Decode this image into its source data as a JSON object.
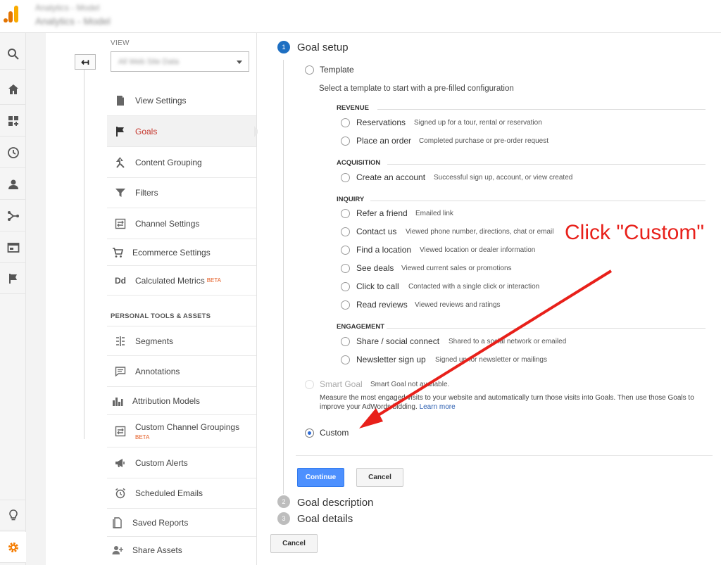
{
  "header": {
    "account_line1": "Analytics - Model",
    "account_line2": "Analytics - Model"
  },
  "rail": {
    "items": [
      "search-icon",
      "home-icon",
      "dashboard-icon",
      "clock-icon",
      "person-icon",
      "flow-icon",
      "window-icon",
      "flag-icon"
    ],
    "bottom": [
      "lightbulb-icon",
      "gear-icon"
    ],
    "accent": "#f57c00"
  },
  "admin": {
    "view_label": "VIEW",
    "view_value": "All Web Site Data",
    "menu": [
      {
        "label": "View Settings"
      },
      {
        "label": "Goals"
      },
      {
        "label": "Content Grouping"
      },
      {
        "label": "Filters"
      },
      {
        "label": "Channel Settings"
      },
      {
        "label": "Ecommerce Settings"
      },
      {
        "label": "Calculated Metrics",
        "badge": "BETA"
      }
    ],
    "section_head": "PERSONAL TOOLS & ASSETS",
    "tools": [
      {
        "label": "Segments"
      },
      {
        "label": "Annotations"
      },
      {
        "label": "Attribution Models"
      },
      {
        "label": "Custom Channel Groupings",
        "badge": "BETA"
      },
      {
        "label": "Custom Alerts"
      },
      {
        "label": "Scheduled Emails"
      },
      {
        "label": "Saved Reports"
      },
      {
        "label": "Share Assets"
      }
    ],
    "dd_glyph": "Dd"
  },
  "goal": {
    "steps": [
      {
        "num": "1",
        "title": "Goal setup"
      },
      {
        "num": "2",
        "title": "Goal description"
      },
      {
        "num": "3",
        "title": "Goal details"
      }
    ],
    "template_label": "Template",
    "template_hint": "Select a template to start with a pre-filled configuration",
    "categories": [
      {
        "name": "REVENUE",
        "options": [
          {
            "label": "Reservations",
            "desc": "Signed up for a tour, rental or reservation"
          },
          {
            "label": "Place an order",
            "desc": "Completed purchase or pre-order request"
          }
        ]
      },
      {
        "name": "ACQUISITION",
        "options": [
          {
            "label": "Create an account",
            "desc": "Successful sign up, account, or view created"
          }
        ]
      },
      {
        "name": "INQUIRY",
        "options": [
          {
            "label": "Refer a friend",
            "desc": "Emailed link"
          },
          {
            "label": "Contact us",
            "desc": "Viewed phone number, directions, chat or email"
          },
          {
            "label": "Find a location",
            "desc": "Viewed location or dealer information"
          },
          {
            "label": "See deals",
            "desc": "Viewed current sales or promotions"
          },
          {
            "label": "Click to call",
            "desc": "Contacted with a single click or interaction"
          },
          {
            "label": "Read reviews",
            "desc": "Viewed reviews and ratings"
          }
        ]
      },
      {
        "name": "ENGAGEMENT",
        "options": [
          {
            "label": "Share / social connect",
            "desc": "Shared to a social network or emailed"
          },
          {
            "label": "Newsletter sign up",
            "desc": "Signed up for newsletter or mailings"
          }
        ]
      }
    ],
    "smart_label": "Smart Goal",
    "smart_note": "Smart Goal not available.",
    "smart_desc": "Measure the most engaged visits to your website and automatically turn those visits into Goals. Then use those Goals to improve your AdWords bidding.",
    "learn_more": "Learn more",
    "custom_label": "Custom",
    "custom_selected": true,
    "continue_label": "Continue",
    "cancel_label": "Cancel",
    "bottom_cancel_label": "Cancel",
    "primary_color": "#4d90fe"
  },
  "annotation": {
    "text": "Click \"Custom\"",
    "color": "#e8201a"
  }
}
